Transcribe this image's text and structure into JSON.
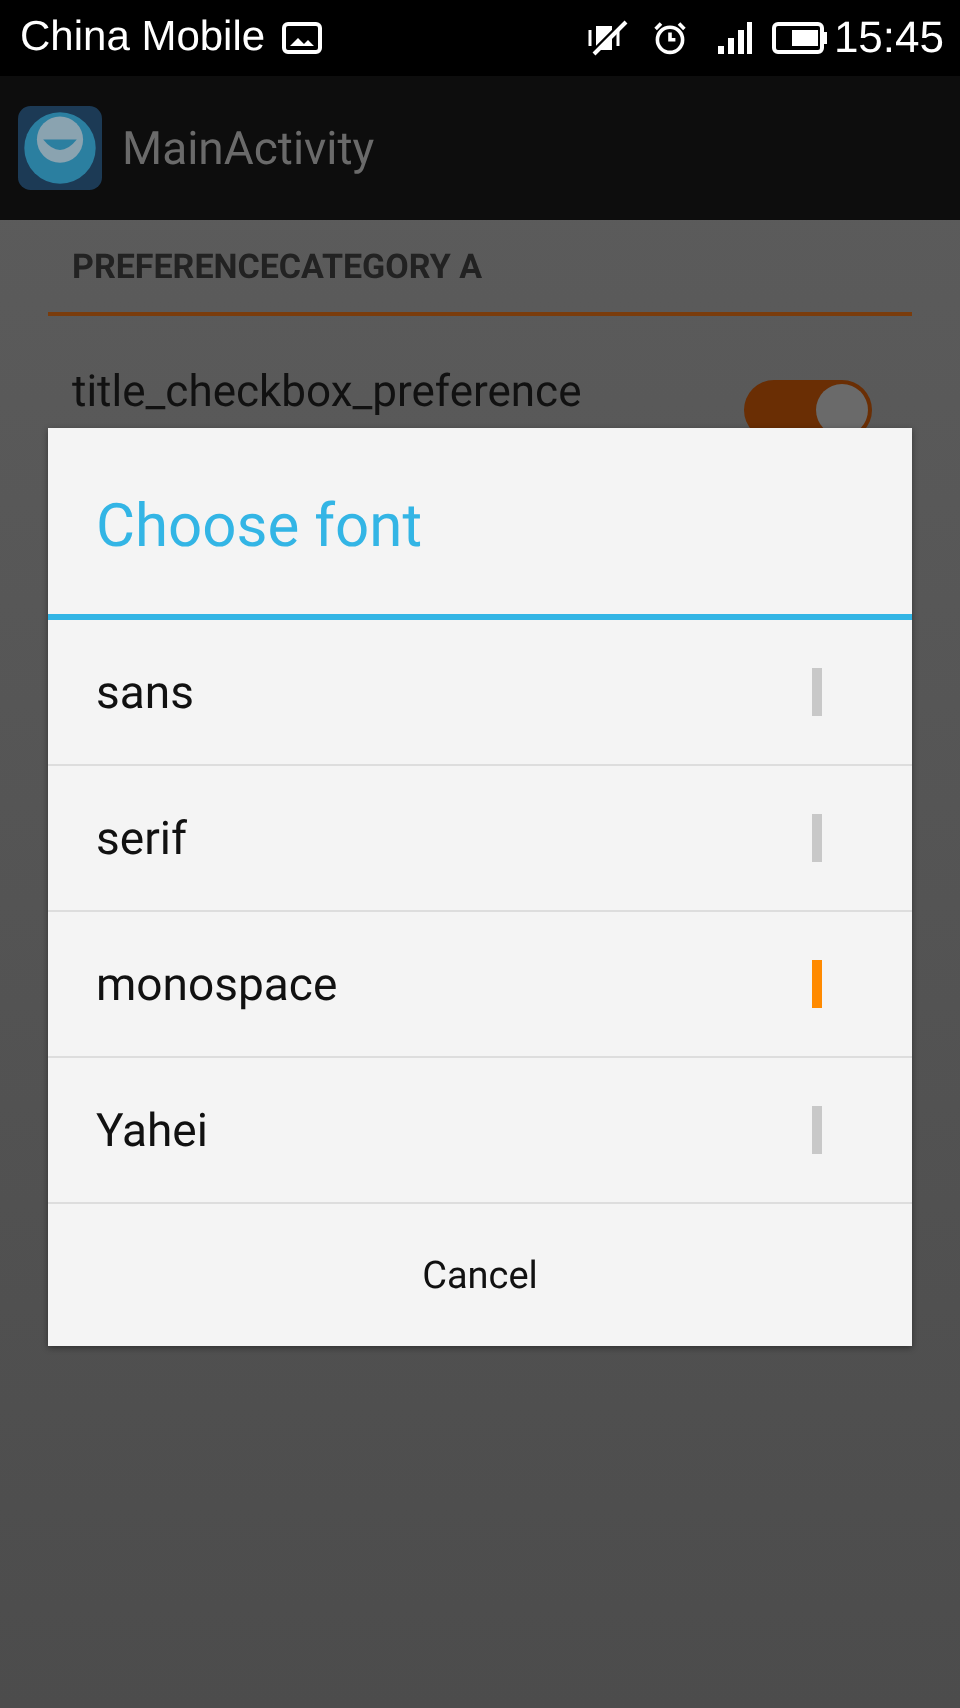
{
  "status_bar": {
    "carrier": "China Mobile",
    "time": "15:45"
  },
  "action_bar": {
    "title": "MainActivity"
  },
  "preferences": {
    "category": "PREFERENCECATEGORY A",
    "items": [
      {
        "title": "title_checkbox_preference",
        "checked": true
      }
    ]
  },
  "dialog": {
    "title": "Choose font",
    "options": [
      {
        "label": "sans",
        "selected": false
      },
      {
        "label": "serif",
        "selected": false
      },
      {
        "label": "monospace",
        "selected": true
      },
      {
        "label": "Yahei",
        "selected": false
      }
    ],
    "cancel": "Cancel"
  }
}
